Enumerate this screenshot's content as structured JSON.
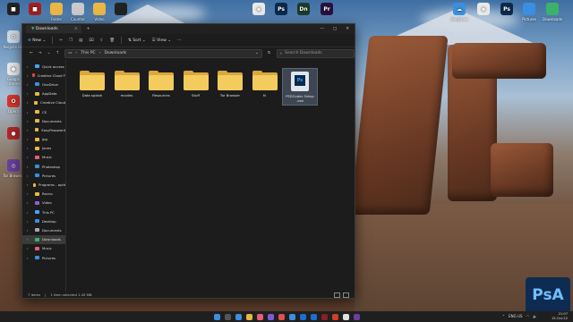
{
  "window": {
    "tab_title": "Downloads",
    "new_label": "New",
    "sort_label": "Sort",
    "view_label": "View",
    "breadcrumb": [
      "This PC",
      "Downloads"
    ],
    "search_placeholder": "Search Downloads"
  },
  "nav": {
    "items": [
      {
        "label": "Quick access",
        "color": "#4aa3ff"
      },
      {
        "label": "Creative Cloud F",
        "color": "#e0473b"
      },
      {
        "label": "OneDrive",
        "color": "#3b8fe0"
      },
      {
        "label": "AppData",
        "color": "#e8b746"
      },
      {
        "label": "Creative Cloud",
        "color": "#e8b746"
      },
      {
        "label": "CS",
        "color": "#e8b746"
      },
      {
        "label": "Documents",
        "color": "#e8b746"
      },
      {
        "label": "EasyPassword",
        "color": "#e8b746"
      },
      {
        "label": "Jpg",
        "color": "#e8b746"
      },
      {
        "label": "Janes",
        "color": "#e8b746"
      },
      {
        "label": "Music",
        "color": "#e85c7c"
      },
      {
        "label": "Photoshop",
        "color": "#3b8fe0"
      },
      {
        "label": "Pictures",
        "color": "#3b8fe0"
      },
      {
        "label": "Programs - apld",
        "color": "#e8b746"
      },
      {
        "label": "Racno",
        "color": "#e8b746"
      },
      {
        "label": "Video",
        "color": "#8a62d8"
      },
      {
        "label": "This PC",
        "color": "#4aa3ff"
      },
      {
        "label": "Desktop",
        "color": "#3b8fe0"
      },
      {
        "label": "Documents",
        "color": "#aaaaaa"
      },
      {
        "label": "Downloads",
        "color": "#3bb26a"
      },
      {
        "label": "Music",
        "color": "#e85c7c"
      },
      {
        "label": "Pictures",
        "color": "#3b8fe0"
      }
    ],
    "selected_index": 19
  },
  "files": [
    {
      "name": "Data splash",
      "type": "folder"
    },
    {
      "name": "movies",
      "type": "folder"
    },
    {
      "name": "Resources",
      "type": "folder"
    },
    {
      "name": "Stuff",
      "type": "folder"
    },
    {
      "name": "Tor Browser",
      "type": "folder"
    },
    {
      "name": "tt",
      "type": "folder"
    },
    {
      "name": "PSDCodec Setup .exe",
      "type": "exe"
    }
  ],
  "status": {
    "count": "7 items",
    "selected": "1 item selected  1.45 MB"
  },
  "desktop_icons_left": [
    {
      "label": "Recycle Bin",
      "glyph": "♻",
      "color": "#cfd8e3"
    },
    {
      "label": "Google Chrome",
      "glyph": "●",
      "color": "#e9e9e9"
    },
    {
      "label": "Opera",
      "glyph": "O",
      "color": "#d9342c"
    },
    {
      "label": "",
      "glyph": "●",
      "color": "#b3262c"
    },
    {
      "label": "Tor Browser",
      "glyph": "◎",
      "color": "#6a3fa0"
    }
  ],
  "desktop_icons_top": [
    {
      "label": "",
      "glyph": "■",
      "color": "#222"
    },
    {
      "label": "",
      "glyph": "■",
      "color": "#a12020"
    },
    {
      "label": "Folder",
      "glyph": "",
      "color": "#e8b746"
    },
    {
      "label": "Counter",
      "glyph": "",
      "color": "#c9c9c9"
    },
    {
      "label": "Video",
      "glyph": "",
      "color": "#e8b746"
    },
    {
      "label": "",
      "glyph": "",
      "color": "#222"
    }
  ],
  "desktop_icons_right": [
    {
      "label": "",
      "glyph": "◉",
      "color": "#e9e9e9"
    },
    {
      "label": "",
      "glyph": "Ps",
      "color": "#0b2a4d"
    },
    {
      "label": "",
      "glyph": "Dn",
      "color": "#1c3b2a"
    },
    {
      "label": "",
      "glyph": "Pr",
      "color": "#2a1040"
    },
    {
      "label": "OneDrive",
      "glyph": "☁",
      "color": "#3b8fe0"
    },
    {
      "label": "",
      "glyph": "◉",
      "color": "#e9e9e9"
    },
    {
      "label": "",
      "glyph": "Ps",
      "color": "#0b2a4d"
    },
    {
      "label": "Pictures",
      "glyph": "",
      "color": "#3b8fe0"
    },
    {
      "label": "Downloads",
      "glyph": "",
      "color": "#3bb26a"
    }
  ],
  "taskbar": {
    "time": "21:07",
    "date": "15-Oct-22",
    "lang": "ENG US",
    "apps": [
      "#3b8fe0",
      "#e8b746",
      "#e85c7c",
      "#7a5cd8",
      "#e05050",
      "#3b8fe0",
      "#1a6fd1",
      "#1a6fd1",
      "#8b2020",
      "#d04020",
      "#e0e0e0",
      "#6a3fa0"
    ]
  },
  "brand_badge": "PsA"
}
